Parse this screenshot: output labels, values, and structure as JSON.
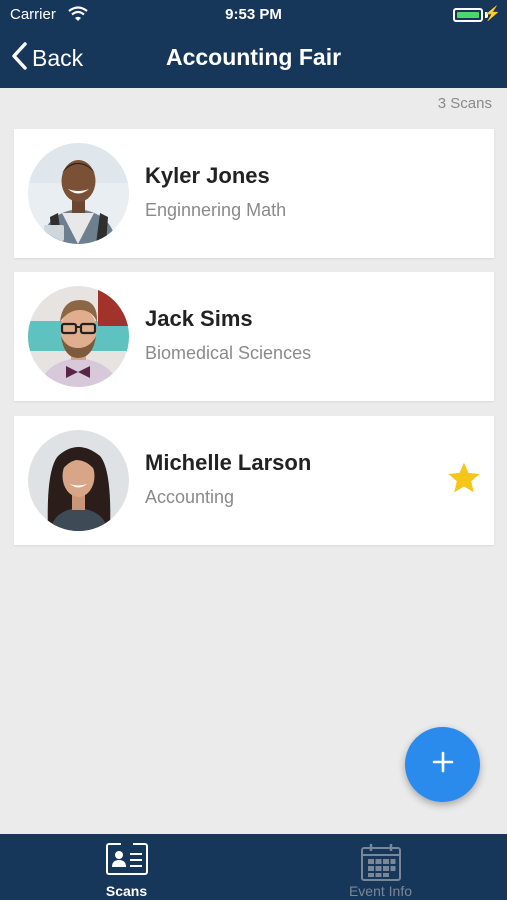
{
  "status_bar": {
    "carrier": "Carrier",
    "time": "9:53 PM",
    "battery_level": 1.0
  },
  "nav": {
    "back_label": "Back",
    "title": "Accounting Fair"
  },
  "scan_count": "3 Scans",
  "contacts": [
    {
      "name": "Kyler Jones",
      "department": "Enginnering Math",
      "starred": false
    },
    {
      "name": "Jack Sims",
      "department": "Biomedical Sciences",
      "starred": false
    },
    {
      "name": "Michelle Larson",
      "department": "Accounting",
      "starred": true
    }
  ],
  "fab": {
    "icon": "plus-icon"
  },
  "tabs": [
    {
      "label": "Scans",
      "icon": "id-card-icon",
      "active": true
    },
    {
      "label": "Event Info",
      "icon": "calendar-icon",
      "active": false
    }
  ],
  "colors": {
    "header": "#16375a",
    "accent": "#2b8bec",
    "star": "#f5c518",
    "background": "#ebebeb"
  }
}
